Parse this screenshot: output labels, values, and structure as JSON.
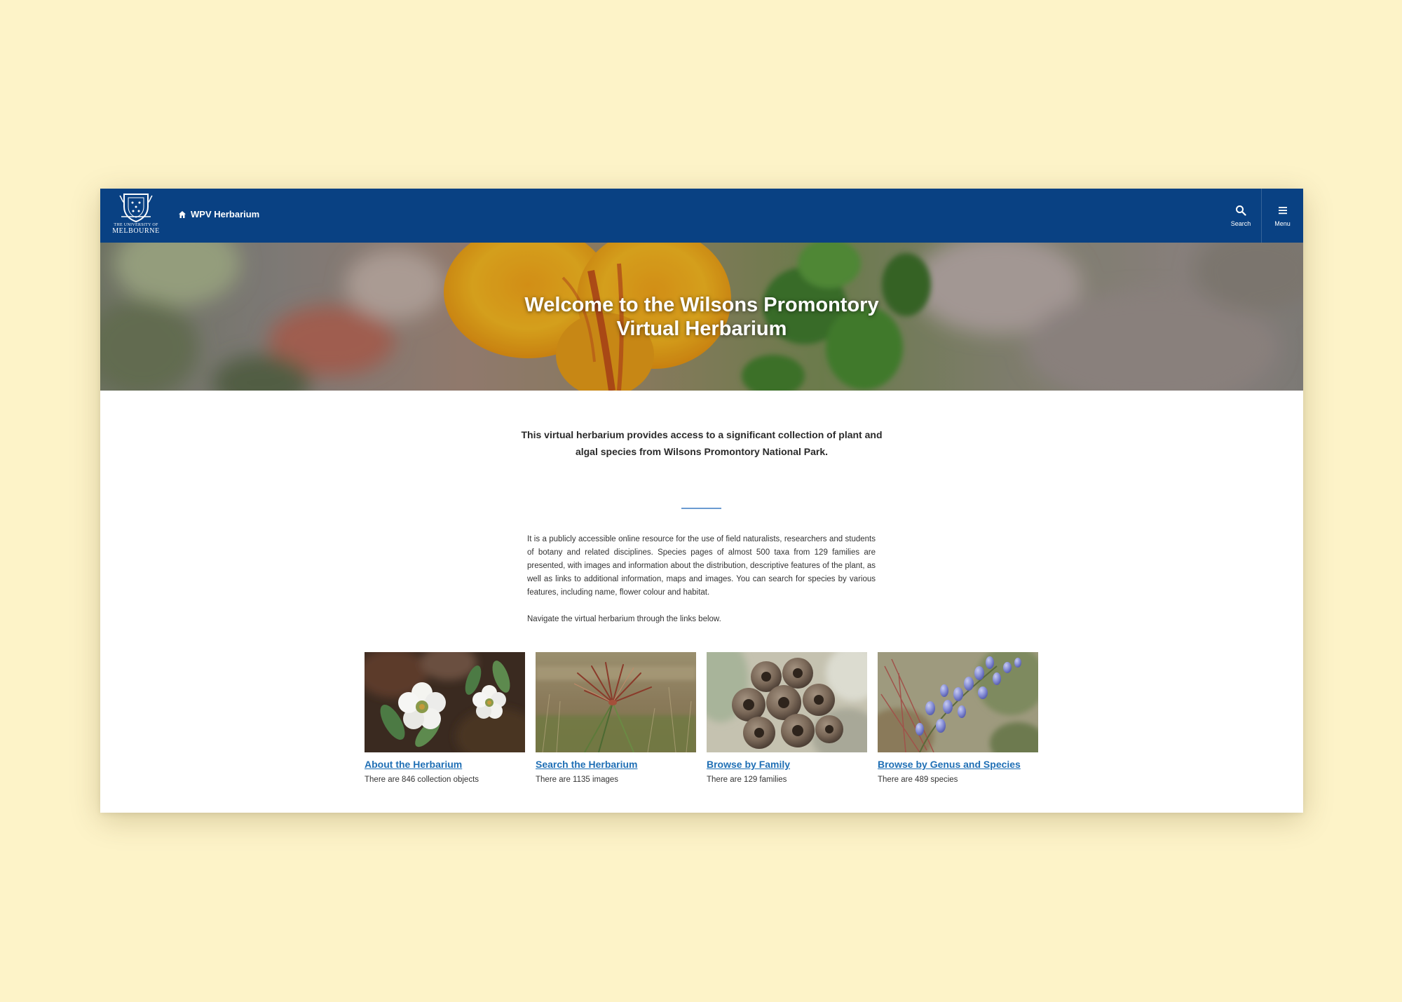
{
  "header": {
    "logo_line1": "THE UNIVERSITY OF",
    "logo_line2": "MELBOURNE",
    "breadcrumb_label": "WPV Herbarium",
    "search_label": "Search",
    "menu_label": "Menu",
    "background_color": "#094183"
  },
  "hero": {
    "title_line1": "Welcome to the Wilsons Promontory",
    "title_line2": "Virtual Herbarium"
  },
  "main": {
    "lead_line1": "This virtual herbarium provides access to a significant collection of plant and",
    "lead_line2": "algal species from Wilsons Promontory National Park.",
    "body_paragraph1": "It is a publicly accessible online resource for the use of field naturalists, researchers and students of botany and related disciplines. Species pages of almost 500 taxa from 129 families are presented, with images and information about the distribution, descriptive features of the plant, as well as links to additional information, maps and images. You can search for species by various features, including name, flower colour and habitat.",
    "body_paragraph2": "Navigate the virtual herbarium through the links below."
  },
  "cards": [
    {
      "title": "About the Herbarium",
      "count_text": "There are 846 collection objects"
    },
    {
      "title": "Search the Herbarium",
      "count_text": "There are 1135 images"
    },
    {
      "title": "Browse by Family",
      "count_text": "There are 129 families"
    },
    {
      "title": "Browse by Genus and Species",
      "count_text": "There are 489 species"
    }
  ],
  "colors": {
    "page_background": "#fdf3c8",
    "link": "#1f6fb5",
    "divider": "#6b9bd1"
  }
}
